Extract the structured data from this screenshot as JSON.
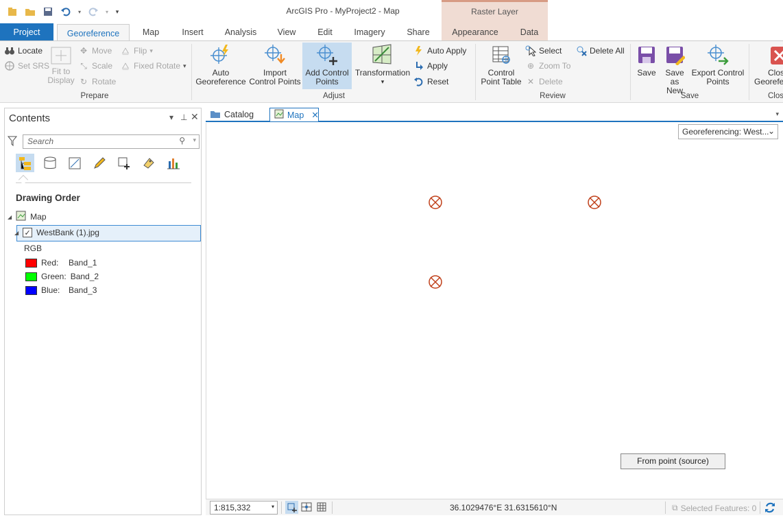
{
  "app": {
    "title": "ArcGIS Pro - MyProject2 - Map",
    "context_tab_group": "Raster Layer"
  },
  "tabs": [
    "Project",
    "Georeference",
    "Map",
    "Insert",
    "Analysis",
    "View",
    "Edit",
    "Imagery",
    "Share",
    "Appearance",
    "Data"
  ],
  "ribbon": {
    "prepare": {
      "label": "Prepare",
      "locate": "Locate",
      "set_srs": "Set SRS",
      "fit_to_display_1": "Fit to",
      "fit_to_display_2": "Display",
      "move": "Move",
      "scale": "Scale",
      "rotate": "Rotate",
      "flip": "Flip",
      "fixed_rotate": "Fixed Rotate"
    },
    "adjust": {
      "label": "Adjust",
      "auto_georef_1": "Auto",
      "auto_georef_2": "Georeference",
      "import_cp_1": "Import",
      "import_cp_2": "Control Points",
      "add_cp_1": "Add Control",
      "add_cp_2": "Points",
      "transformation": "Transformation",
      "auto_apply": "Auto Apply",
      "apply": "Apply",
      "reset": "Reset"
    },
    "review": {
      "label": "Review",
      "cp_table_1": "Control",
      "cp_table_2": "Point Table",
      "select": "Select",
      "zoom_to": "Zoom To",
      "delete": "Delete",
      "delete_all": "Delete All"
    },
    "save": {
      "label": "Save",
      "save": "Save",
      "save_as_1": "Save as",
      "save_as_2": "New",
      "export_cp_1": "Export Control",
      "export_cp_2": "Points"
    },
    "close": {
      "label": "Clos",
      "close_1": "Clos",
      "close_2": "Georefe"
    }
  },
  "contents": {
    "title": "Contents",
    "search_placeholder": "Search",
    "drawing_order": "Drawing Order",
    "map_node": "Map",
    "layer": "WestBank (1).jpg",
    "rgb": "RGB",
    "bands": [
      {
        "label": "Red:",
        "band": "Band_1",
        "color": "#ff0000"
      },
      {
        "label": "Green:",
        "band": "Band_2",
        "color": "#00ff00"
      },
      {
        "label": "Blue:",
        "band": "Band_3",
        "color": "#0000ff"
      }
    ]
  },
  "mapview": {
    "tabs": {
      "catalog": "Catalog",
      "map": "Map"
    },
    "georef_dropdown": "Georeferencing: West...",
    "tooltip": "From point (source)",
    "marker_color": "#c0401a"
  },
  "statusbar": {
    "scale": "1:815,332",
    "coordinates": "36.1029476°E 31.6315610°N",
    "selected_features": "Selected Features: 0"
  }
}
